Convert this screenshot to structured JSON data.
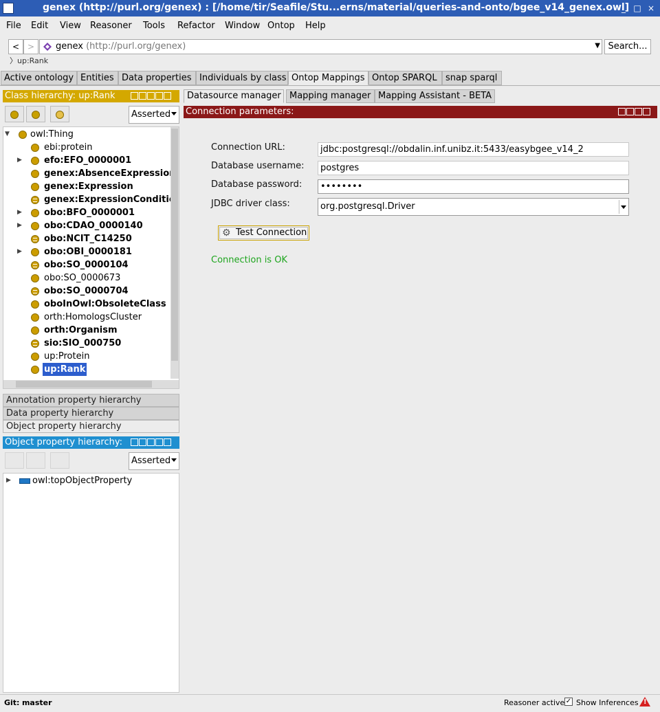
{
  "window": {
    "title": "genex (http://purl.org/genex)  : [/home/tir/Seafile/Stu...erns/material/queries-and-onto/bgee_v14_genex.owl]",
    "controls": [
      "_",
      "□",
      "×"
    ]
  },
  "menu": [
    "File",
    "Edit",
    "View",
    "Reasoner",
    "Tools",
    "Refactor",
    "Window",
    "Ontop",
    "Help"
  ],
  "address": {
    "back": "<",
    "forward": ">",
    "ontology_name": "genex",
    "ontology_iri": "(http://purl.org/genex)",
    "search": "Search...",
    "breadcrumb": "up:Rank"
  },
  "main_tabs": [
    "Active ontology",
    "Entities",
    "Data properties",
    "Individuals by class",
    "Ontop Mappings",
    "Ontop SPARQL",
    "snap sparql"
  ],
  "active_main_tab": "Ontop Mappings",
  "class_hierarchy": {
    "title": "Class hierarchy: up:Rank",
    "mode": "Asserted",
    "root": "owl:Thing",
    "items": [
      {
        "label": "ebi:protein",
        "bold": false,
        "expandable": false,
        "equiv": false
      },
      {
        "label": "efo:EFO_0000001",
        "bold": true,
        "expandable": true,
        "equiv": false
      },
      {
        "label": "genex:AbsenceExpression",
        "bold": true,
        "expandable": false,
        "equiv": false
      },
      {
        "label": "genex:Expression",
        "bold": true,
        "expandable": false,
        "equiv": false
      },
      {
        "label": "genex:ExpressionConditio",
        "bold": true,
        "expandable": false,
        "equiv": true
      },
      {
        "label": "obo:BFO_0000001",
        "bold": true,
        "expandable": true,
        "equiv": false
      },
      {
        "label": "obo:CDAO_0000140",
        "bold": true,
        "expandable": true,
        "equiv": false
      },
      {
        "label": "obo:NCIT_C14250",
        "bold": true,
        "expandable": false,
        "equiv": true
      },
      {
        "label": "obo:OBI_0000181",
        "bold": true,
        "expandable": true,
        "equiv": false
      },
      {
        "label": "obo:SO_0000104",
        "bold": true,
        "expandable": false,
        "equiv": true
      },
      {
        "label": "obo:SO_0000673",
        "bold": false,
        "expandable": false,
        "equiv": false
      },
      {
        "label": "obo:SO_0000704",
        "bold": true,
        "expandable": false,
        "equiv": true
      },
      {
        "label": "oboInOwl:ObsoleteClass",
        "bold": true,
        "expandable": false,
        "equiv": false
      },
      {
        "label": "orth:HomologsCluster",
        "bold": false,
        "expandable": false,
        "equiv": false
      },
      {
        "label": "orth:Organism",
        "bold": true,
        "expandable": false,
        "equiv": false
      },
      {
        "label": "sio:SIO_000750",
        "bold": true,
        "expandable": false,
        "equiv": true
      },
      {
        "label": "up:Protein",
        "bold": false,
        "expandable": false,
        "equiv": false
      },
      {
        "label": "up:Rank",
        "bold": true,
        "expandable": false,
        "equiv": false,
        "selected": true
      }
    ]
  },
  "hierarchy_tabs": [
    "Annotation property hierarchy",
    "Data property hierarchy",
    "Object property hierarchy"
  ],
  "object_property_hierarchy": {
    "title": "Object property hierarchy:",
    "mode": "Asserted",
    "root": "owl:topObjectProperty"
  },
  "sub_tabs": [
    "Datasource manager",
    "Mapping manager",
    "Mapping Assistant - BETA"
  ],
  "active_sub_tab": "Datasource manager",
  "connection": {
    "header": "Connection parameters:",
    "url_label": "Connection URL:",
    "url_value": "jdbc:postgresql://obdalin.inf.unibz.it:5433/easybgee_v14_2",
    "username_label": "Database username:",
    "username_value": "postgres",
    "password_label": "Database password:",
    "password_value": "••••••••",
    "driver_label": "JDBC driver class:",
    "driver_value": "org.postgresql.Driver",
    "test_button": "Test Connection",
    "status": "Connection is OK"
  },
  "statusbar": {
    "git_label": "Git:",
    "git_branch": "master",
    "reasoner": "Reasoner active",
    "show_inferences_checked": true,
    "show_inferences": "Show Inferences"
  },
  "colors": {
    "title_bar": "#2d5db5",
    "class_panel": "#d4a800",
    "object_panel": "#1f8fd0",
    "connection_header": "#8b1818",
    "ok_text": "#1ea51e",
    "selection": "#2c5dcd"
  }
}
